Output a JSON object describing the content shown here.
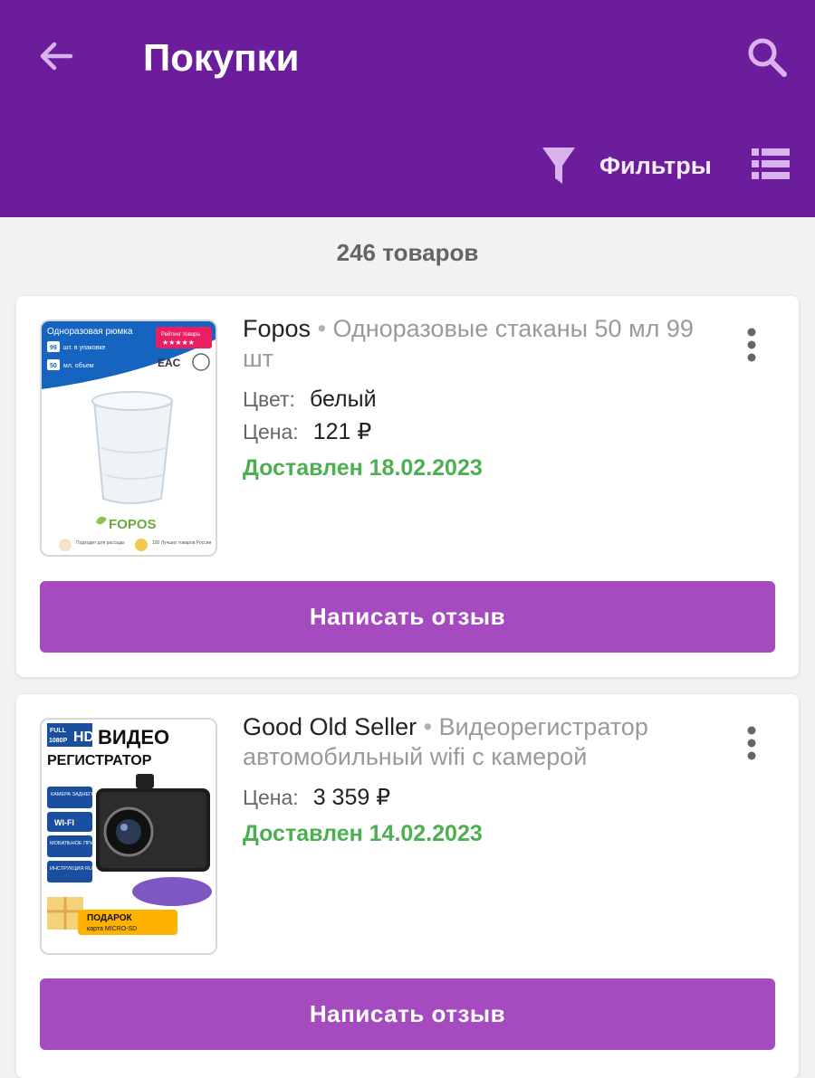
{
  "header": {
    "title": "Покупки",
    "filter_label": "Фильтры",
    "back_icon": "arrow-left-icon",
    "search_icon": "search-icon",
    "filter_icon": "filter-icon",
    "view_icon": "list-view-icon",
    "bg_color": "#6c1d9c"
  },
  "summary": {
    "count_text": "246 товаров"
  },
  "orders": [
    {
      "brand": "Fopos",
      "separator": "•",
      "name": "Одноразовые стаканы 50 мл 99 шт",
      "color_label": "Цвет:",
      "color_value": "белый",
      "price_label": "Цена:",
      "price_value": "121 ₽",
      "status": "Доставлен 18.02.2023",
      "review_label": "Написать отзыв",
      "image": {
        "banner": "Одноразовая рюмка",
        "qty_num": "99",
        "qty_text": "шт. в упаковке",
        "vol_num": "50",
        "vol_text": "мл. объем",
        "rating_label": "Рейтинг товара",
        "stars": "★★★★★",
        "eac": "EAC",
        "logo": "FOPOS",
        "badge1": "Подходит для рассады",
        "badge2": "100 Лучших товаров России"
      }
    },
    {
      "brand": "Good Old Seller",
      "separator": "•",
      "name": "Видеорегистратор автомобильный wifi с камерой",
      "price_label": "Цена:",
      "price_value": "3 359 ₽",
      "status": "Доставлен 14.02.2023",
      "review_label": "Написать отзыв",
      "image": {
        "full": "FULL",
        "res": "1080P",
        "hd": "HD",
        "title1": "ВИДЕО",
        "title2": "РЕГИСТРАТОР",
        "feat1": "КАМЕРА ЗАДНЕГО ВИДА",
        "feat2": "WI-FI",
        "feat3": "МОБИЛЬНОЕ ПРИЛОЖЕНИЕ",
        "feat4": "ИНСТРУКЦИЯ RUS",
        "gift1": "ПОДАРОК",
        "gift2": "карта MICRO-SD"
      }
    }
  ],
  "colors": {
    "accent_button": "#a64bbf",
    "delivered": "#4caf50"
  }
}
